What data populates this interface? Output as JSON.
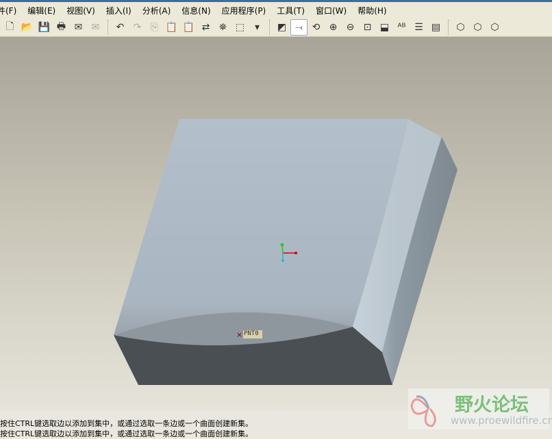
{
  "menu": [
    "件(F)",
    "编辑(E)",
    "视图(V)",
    "插入(I)",
    "分析(A)",
    "信息(N)",
    "应用程序(P)",
    "工具(T)",
    "窗口(W)",
    "帮助(H)"
  ],
  "toolbar": [
    {
      "icon": "new-icon",
      "g": "🗋"
    },
    {
      "icon": "open-icon",
      "g": "📂"
    },
    {
      "icon": "save-icon",
      "g": "💾"
    },
    {
      "icon": "print-icon",
      "g": "🖶"
    },
    {
      "icon": "send-mail-icon",
      "g": "✉"
    },
    {
      "icon": "mail-attach-icon",
      "g": "✉",
      "dim": true
    },
    {
      "sep": true
    },
    {
      "icon": "undo-icon",
      "g": "↶"
    },
    {
      "icon": "redo-icon",
      "g": "↷",
      "dim": true
    },
    {
      "icon": "copy-icon",
      "g": "⎘",
      "dim": true
    },
    {
      "icon": "paste-icon",
      "g": "📋",
      "dim": true
    },
    {
      "icon": "paste-special-icon",
      "g": "📋",
      "dim": true
    },
    {
      "icon": "regenerate-icon",
      "g": "⇄"
    },
    {
      "icon": "find-icon",
      "g": "⛯"
    },
    {
      "icon": "selection-box-icon",
      "g": "⬚"
    },
    {
      "icon": "dropdown-arrow-icon",
      "g": "▾"
    },
    {
      "sep": true
    },
    {
      "icon": "repaint-icon",
      "g": "◩"
    },
    {
      "icon": "spin-center-icon",
      "g": "⤙",
      "active": true
    },
    {
      "icon": "orient-mode-icon",
      "g": "⟲"
    },
    {
      "icon": "zoom-in-icon",
      "g": "⊕"
    },
    {
      "icon": "zoom-out-icon",
      "g": "⊖"
    },
    {
      "icon": "refit-icon",
      "g": "⊡"
    },
    {
      "icon": "reorient-icon",
      "g": "⬓"
    },
    {
      "icon": "saved-views-icon",
      "g": "ᴬᴮ"
    },
    {
      "icon": "layers-icon",
      "g": "☰"
    },
    {
      "icon": "view-manager-icon",
      "g": "▤"
    },
    {
      "sep": true
    },
    {
      "icon": "wireframe-icon",
      "g": "⬡"
    },
    {
      "icon": "hidden-line-icon",
      "g": "⬡"
    },
    {
      "icon": "no-hidden-icon",
      "g": "⬡"
    }
  ],
  "model": {
    "point_label": "PNT0"
  },
  "status": {
    "messages": [
      "按住CTRL键选取边以添加到集中，或通过选取一条边或一个曲面创建新集。",
      "按住CTRL键选取边以添加到集中，或通过选取一条边或一个曲面创建新集。"
    ]
  },
  "watermark": {
    "title": "野火论坛",
    "url": "www.proewildfire.cn"
  }
}
